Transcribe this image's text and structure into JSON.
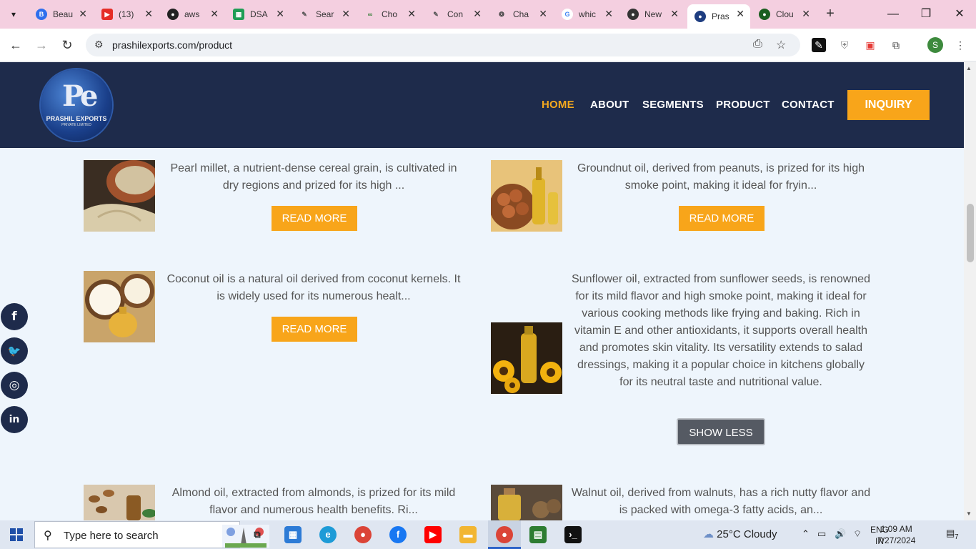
{
  "browser": {
    "tabs": [
      {
        "label": "Beau",
        "icon": "b-icon",
        "color": "#2f6fed",
        "glyph": "B"
      },
      {
        "label": "(13)",
        "icon": "youtube-icon",
        "color": "#e52d27",
        "glyph": "▶"
      },
      {
        "label": "aws",
        "icon": "github-icon",
        "color": "#222222",
        "glyph": "●"
      },
      {
        "label": "DSA",
        "icon": "sheets-icon",
        "color": "#1f9d55",
        "glyph": "▦"
      },
      {
        "label": "Sear",
        "icon": "pen-icon",
        "color": "#555555",
        "glyph": "✎"
      },
      {
        "label": "Cho",
        "icon": "link-icon",
        "color": "#2e7d32",
        "glyph": "∞"
      },
      {
        "label": "Con",
        "icon": "pen-icon",
        "color": "#555555",
        "glyph": "✎"
      },
      {
        "label": "Cha",
        "icon": "openai-icon",
        "color": "#444444",
        "glyph": "❂"
      },
      {
        "label": "whic",
        "icon": "google-icon",
        "color": "#4285f4",
        "glyph": "G"
      },
      {
        "label": "New",
        "icon": "github-icon",
        "color": "#333333",
        "glyph": "●"
      },
      {
        "label": "Pras",
        "icon": "prashil-icon",
        "color": "#1e3d80",
        "glyph": "●"
      },
      {
        "label": "Clou",
        "icon": "leaf-icon",
        "color": "#1b5e20",
        "glyph": "●"
      }
    ],
    "active_tab": "Pras",
    "url": "prashilexports.com/product",
    "profile_initial": "S"
  },
  "site": {
    "logo_mark": "Pe",
    "logo_name": "PRASHIL EXPORTS",
    "logo_sub": "PRIVATE LIMITED",
    "nav": [
      "HOME",
      "ABOUT",
      "SEGMENTS",
      "PRODUCT",
      "CONTACT"
    ],
    "nav_active": "HOME",
    "inquiry_label": "INQUIRY"
  },
  "products": [
    {
      "name": "pearl-millet",
      "desc": "Pearl millet, a nutrient-dense cereal grain, is cultivated in dry regions and prized for its high ...",
      "button": "READ MORE"
    },
    {
      "name": "groundnut-oil",
      "desc": "Groundnut oil, derived from peanuts, is prized for its high smoke point, making it ideal for fryin...",
      "button": "READ MORE"
    },
    {
      "name": "coconut-oil",
      "desc": "Coconut oil is a natural oil derived from coconut kernels. It is widely used for its numerous healt...",
      "button": "READ MORE"
    },
    {
      "name": "sunflower-oil",
      "desc": "Sunflower oil, extracted from sunflower seeds, is renowned for its mild flavor and high smoke point, making it ideal for various cooking methods like frying and baking. Rich in vitamin E and other antioxidants, it supports overall health and promotes skin vitality. Its versatility extends to salad dressings, making it a popular choice in kitchens globally for its neutral taste and nutritional value.",
      "button": "SHOW LESS"
    },
    {
      "name": "almond-oil",
      "desc": "Almond oil, extracted from almonds, is prized for its mild flavor and numerous health benefits. Ri..."
    },
    {
      "name": "walnut-oil",
      "desc": "Walnut oil, derived from walnuts, has a rich nutty flavor and is packed with omega-3 fatty acids, an..."
    }
  ],
  "social": [
    {
      "icon": "facebook-icon",
      "glyph": "f"
    },
    {
      "icon": "twitter-icon",
      "glyph": "🐦"
    },
    {
      "icon": "instagram-icon",
      "glyph": "◎"
    },
    {
      "icon": "linkedin-icon",
      "glyph": "in"
    }
  ],
  "taskbar": {
    "search_placeholder": "Type here to search",
    "weather": "25°C  Cloudy",
    "lang_top": "ENG",
    "lang_bottom": "IN",
    "time": "1:09 AM",
    "date": "7/27/2024",
    "notifications": "7"
  }
}
